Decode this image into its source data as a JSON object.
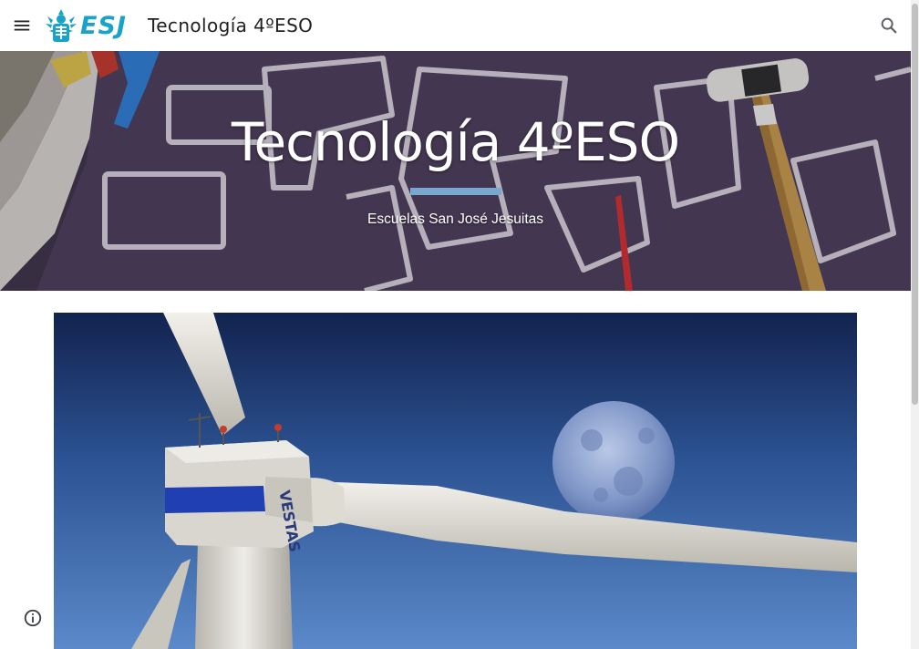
{
  "header": {
    "logo_text": "ESJ",
    "site_title": "Tecnología 4ºESO",
    "menu_icon": "hamburger-menu-icon",
    "search_icon": "search-icon"
  },
  "banner": {
    "title": "Tecnología 4ºESO",
    "subtitle": "Escuelas San José Jesuitas",
    "accent_color": "#7aa7cf"
  },
  "main": {
    "image_description": "wind-turbine-with-moon"
  },
  "footer": {
    "info_icon": "info-icon"
  },
  "colors": {
    "logo": "#1aa3c8",
    "title_text": "#212121",
    "banner_bg": "#4a3d55",
    "sky_top": "#16275a",
    "sky_bottom": "#4a78bd"
  }
}
